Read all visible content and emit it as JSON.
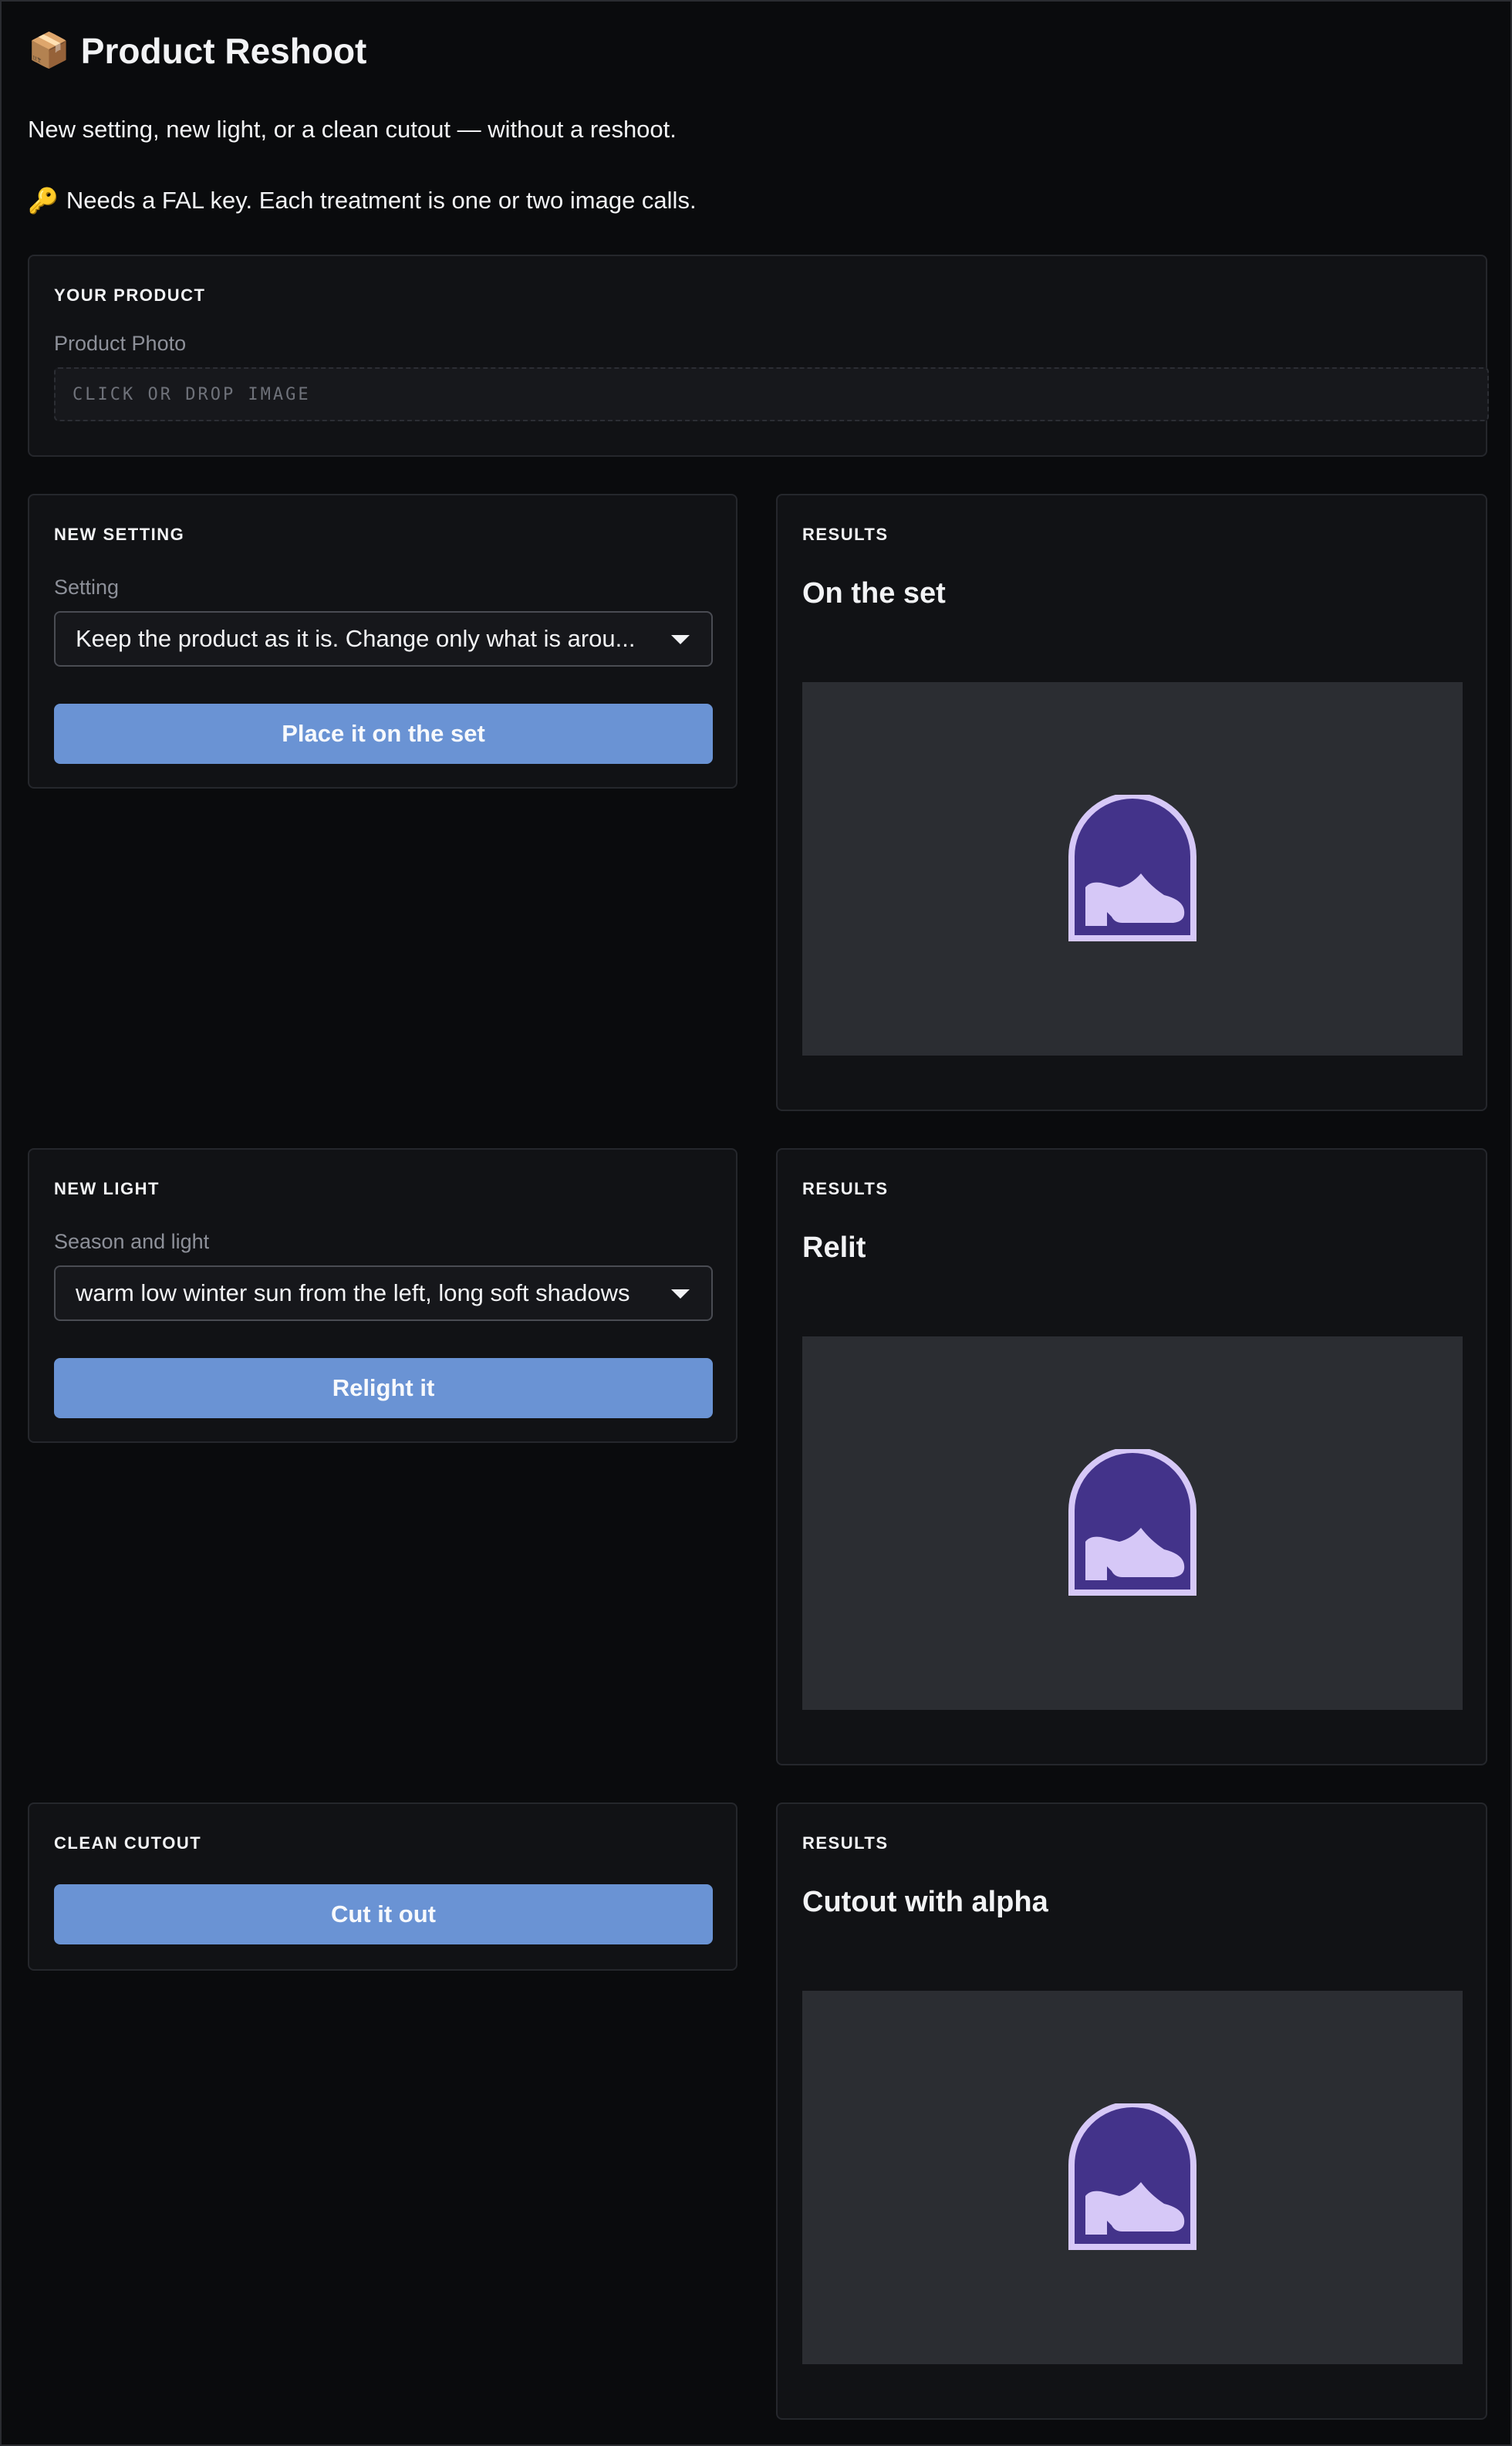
{
  "header": {
    "title_emoji": "📦",
    "title": "Product Reshoot",
    "subtitle": "New setting, new light, or a clean cutout — without a reshoot.",
    "key_icon": "🔑",
    "key_note": "Needs a FAL key. Each treatment is one or two image calls."
  },
  "product": {
    "section_label": "YOUR PRODUCT",
    "photo_label": "Product Photo",
    "dropzone_text": "CLICK OR DROP IMAGE"
  },
  "setting": {
    "section_label": "NEW SETTING",
    "field_label": "Setting",
    "selected_value": "Keep the product as it is. Change only what is arou...",
    "button_label": "Place it on the set"
  },
  "setting_results": {
    "section_label": "RESULTS",
    "title": "On the set",
    "icon": "shoe-placeholder-icon"
  },
  "light": {
    "section_label": "NEW LIGHT",
    "field_label": "Season and light",
    "selected_value": "warm low winter sun from the left, long soft shadows",
    "button_label": "Relight it"
  },
  "light_results": {
    "section_label": "RESULTS",
    "title": "Relit",
    "icon": "shoe-placeholder-icon"
  },
  "cutout": {
    "section_label": "CLEAN CUTOUT",
    "button_label": "Cut it out"
  },
  "cutout_results": {
    "section_label": "RESULTS",
    "title": "Cutout with alpha",
    "icon": "shoe-placeholder-icon"
  },
  "colors": {
    "background": "#0a0b0d",
    "panel": "#111215",
    "accent_button": "#6a93d4",
    "image_placeholder": "#2b2d32",
    "icon_fill": "#43338a",
    "icon_stroke": "#d6c8f7"
  }
}
